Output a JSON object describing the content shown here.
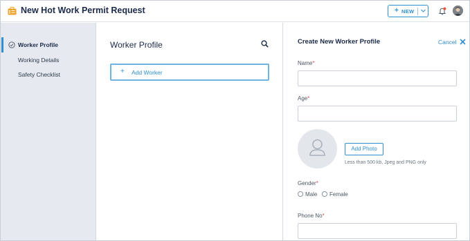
{
  "header": {
    "title": "New Hot Work Permit Request",
    "new_button": {
      "label": "NEW"
    }
  },
  "sidebar": {
    "items": [
      {
        "label": "Worker Profile",
        "active": true
      },
      {
        "label": "Working Details",
        "active": false
      },
      {
        "label": "Safety Checklist",
        "active": false
      }
    ]
  },
  "middle": {
    "title": "Worker Profile",
    "add_worker_label": "Add Worker"
  },
  "form": {
    "title": "Create New Worker Profile",
    "cancel_label": "Cancel",
    "required_marker": "*",
    "name_label": "Name",
    "name_value": "",
    "age_label": "Age",
    "age_value": "",
    "add_photo_label": "Add Photo",
    "photo_hint": "Less than 500 kb, Jpeg and PNG only",
    "gender_label": "Gender",
    "gender_options": [
      "Male",
      "Female"
    ],
    "phone_label": "Phone No",
    "phone_value": ""
  },
  "icons": {
    "app": "briefcase-icon",
    "new_dropdown": "chevron-down-icon",
    "notifications": "bell-icon",
    "search": "search-icon",
    "close": "close-icon",
    "photo_placeholder": "person-icon",
    "step_done": "check-circle-icon"
  },
  "colors": {
    "accent": "#2f8fd0",
    "brand_icon": "#f0a32a",
    "required": "#e0485c",
    "notification_dot": "#e8553d",
    "sidebar_bg": "#e6eaf0"
  }
}
